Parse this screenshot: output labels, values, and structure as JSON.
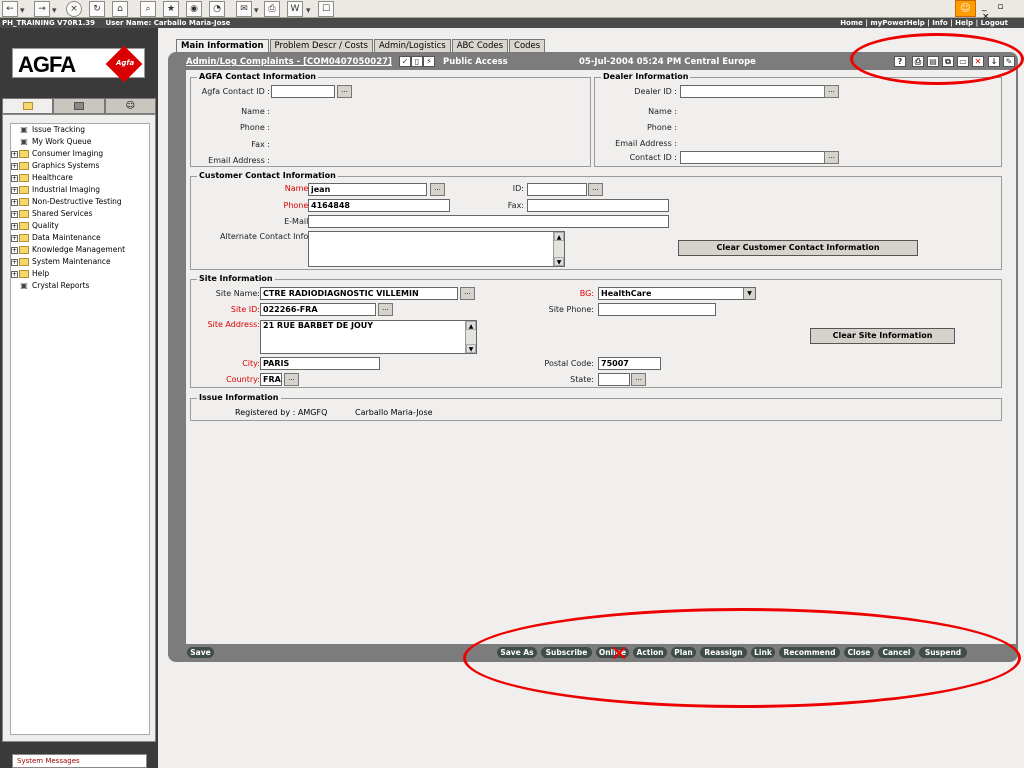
{
  "infobar": {
    "title": "PH_TRAINING V70R1.39",
    "user": "User Name: Carballo Maria-Jose",
    "links": "Home | myPowerHelp | Info | Help | Logout"
  },
  "logo": {
    "text": "AGFA",
    "badge": "Agfa"
  },
  "nav": {
    "items": [
      {
        "label": "Issue Tracking",
        "expand": false
      },
      {
        "label": "My Work Queue",
        "expand": false
      },
      {
        "label": "Consumer Imaging",
        "expand": true
      },
      {
        "label": "Graphics Systems",
        "expand": true
      },
      {
        "label": "Healthcare",
        "expand": true
      },
      {
        "label": "Industrial Imaging",
        "expand": true
      },
      {
        "label": "Non-Destructive Testing",
        "expand": true
      },
      {
        "label": "Shared Services",
        "expand": true
      },
      {
        "label": "Quality",
        "expand": true
      },
      {
        "label": "Data Maintenance",
        "expand": true
      },
      {
        "label": "Knowledge Management",
        "expand": true
      },
      {
        "label": "System Maintenance",
        "expand": true
      },
      {
        "label": "Help",
        "expand": true
      },
      {
        "label": "Crystal Reports",
        "expand": false
      }
    ],
    "system_messages": "System Messages"
  },
  "tabs": [
    "Main Information",
    "Problem Descr / Costs",
    "Admin/Logistics",
    "ABC Codes",
    "Codes"
  ],
  "titlebar": {
    "record": "Admin/Log Complaints - [COM0407050027]",
    "access": "Public Access",
    "datetime": "05-Jul-2004 05:24 PM Central Europe"
  },
  "agfa_contact": {
    "legend": "AGFA Contact Information",
    "id_label": "Agfa Contact ID :",
    "id_value": "",
    "name_label": "Name :",
    "phone_label": "Phone :",
    "fax_label": "Fax :",
    "email_label": "Email Address :"
  },
  "dealer": {
    "legend": "Dealer Information",
    "id_label": "Dealer ID :",
    "id_value": "",
    "name_label": "Name :",
    "phone_label": "Phone :",
    "email_label": "Email Address :",
    "contact_label": "Contact ID :",
    "contact_value": ""
  },
  "customer": {
    "legend": "Customer Contact Information",
    "name_label": "Name:",
    "name_value": "jean",
    "id_label": "ID:",
    "id_value": "",
    "phone_label": "Phone:",
    "phone_value": "4164848",
    "fax_label": "Fax:",
    "fax_value": "",
    "email_label": "E-Mail:",
    "email_value": "",
    "alt_label": "Alternate Contact Info:",
    "alt_value": "",
    "clear_button": "Clear Customer Contact Information"
  },
  "site": {
    "legend": "Site Information",
    "name_label": "Site Name:",
    "name_value": "CTRE RADIODIAGNOSTIC VILLEMIN",
    "bg_label": "BG:",
    "bg_value": "HealthCare",
    "id_label": "Site ID:",
    "id_value": "022266-FRA",
    "phone_label": "Site Phone:",
    "phone_value": "",
    "address_label": "Site Address:",
    "address_value": "21 RUE BARBET DE JOUY",
    "clear_button": "Clear Site Information",
    "city_label": "City:",
    "city_value": "PARIS",
    "postal_label": "Postal Code:",
    "postal_value": "75007",
    "country_label": "Country:",
    "country_value": "FRA",
    "state_label": "State:",
    "state_value": ""
  },
  "issue": {
    "legend": "Issue Information",
    "registered_label": "Registered by : AMGFQ",
    "registered_name": "Carballo Maria-Jose"
  },
  "actions": {
    "save": "Save",
    "buttons": [
      "Save As",
      "Subscribe",
      "Online",
      "Action",
      "Plan",
      "Reassign",
      "Link",
      "Recommend",
      "Close",
      "Cancel",
      "Suspend"
    ]
  },
  "colors": {
    "annotation": "#e00000",
    "frame": "#7c7c7c",
    "pill": "#3f4d4a",
    "required_label": "#d00000"
  }
}
